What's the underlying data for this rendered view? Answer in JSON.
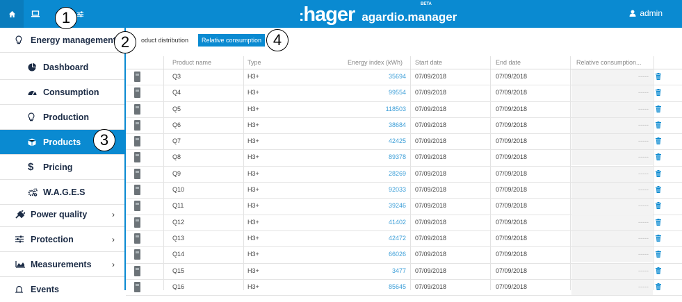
{
  "header": {
    "logo_colon": ":",
    "logo_text": "hager",
    "app_name": "agardio.manager",
    "beta": "BETA",
    "user": "admin",
    "icons": [
      "home-icon",
      "monitor-icon",
      "sliders-icon",
      "user-icon"
    ]
  },
  "callouts": [
    "1",
    "2",
    "3",
    "4"
  ],
  "sidebar": {
    "energy_management": "Energy management",
    "items": [
      {
        "label": "Dashboard",
        "icon": "pie-chart-icon"
      },
      {
        "label": "Consumption",
        "icon": "gauge-icon"
      },
      {
        "label": "Production",
        "icon": "lightbulb-icon"
      },
      {
        "label": "Products",
        "icon": "box-icon"
      },
      {
        "label": "Pricing",
        "icon": "dollar-icon"
      },
      {
        "label": "W.A.G.E.S",
        "icon": "gears-icon"
      }
    ],
    "power_quality": "Power quality",
    "protection": "Protection",
    "measurements": "Measurements",
    "events": "Events",
    "chevron": "›"
  },
  "tabs": {
    "product_distribution": "oduct distribution",
    "relative_consumption": "Relative consumption"
  },
  "table": {
    "headers": [
      "Product name",
      "Type",
      "Energy index (kWh)",
      "Start date",
      "End date",
      "Relative consumption..."
    ],
    "rows": [
      {
        "name": "Q3",
        "type": "H3+",
        "energy": "35694",
        "start": "07/09/2018",
        "end": "07/09/2018",
        "rel": "-----"
      },
      {
        "name": "Q4",
        "type": "H3+",
        "energy": "99554",
        "start": "07/09/2018",
        "end": "07/09/2018",
        "rel": "-----"
      },
      {
        "name": "Q5",
        "type": "H3+",
        "energy": "118503",
        "start": "07/09/2018",
        "end": "07/09/2018",
        "rel": "-----"
      },
      {
        "name": "Q6",
        "type": "H3+",
        "energy": "38684",
        "start": "07/09/2018",
        "end": "07/09/2018",
        "rel": "-----"
      },
      {
        "name": "Q7",
        "type": "H3+",
        "energy": "42425",
        "start": "07/09/2018",
        "end": "07/09/2018",
        "rel": "-----"
      },
      {
        "name": "Q8",
        "type": "H3+",
        "energy": "89378",
        "start": "07/09/2018",
        "end": "07/09/2018",
        "rel": "-----"
      },
      {
        "name": "Q9",
        "type": "H3+",
        "energy": "28269",
        "start": "07/09/2018",
        "end": "07/09/2018",
        "rel": "-----"
      },
      {
        "name": "Q10",
        "type": "H3+",
        "energy": "92033",
        "start": "07/09/2018",
        "end": "07/09/2018",
        "rel": "-----"
      },
      {
        "name": "Q11",
        "type": "H3+",
        "energy": "39246",
        "start": "07/09/2018",
        "end": "07/09/2018",
        "rel": "-----"
      },
      {
        "name": "Q12",
        "type": "H3+",
        "energy": "41402",
        "start": "07/09/2018",
        "end": "07/09/2018",
        "rel": "-----"
      },
      {
        "name": "Q13",
        "type": "H3+",
        "energy": "42472",
        "start": "07/09/2018",
        "end": "07/09/2018",
        "rel": "-----"
      },
      {
        "name": "Q14",
        "type": "H3+",
        "energy": "66026",
        "start": "07/09/2018",
        "end": "07/09/2018",
        "rel": "-----"
      },
      {
        "name": "Q15",
        "type": "H3+",
        "energy": "3477",
        "start": "07/09/2018",
        "end": "07/09/2018",
        "rel": "-----"
      },
      {
        "name": "Q16",
        "type": "H3+",
        "energy": "85645",
        "start": "07/09/2018",
        "end": "07/09/2018",
        "rel": "-----"
      }
    ]
  },
  "colors": {
    "primary": "#0a8ad1",
    "link": "#3d9fd8",
    "nav_text": "#1b2b45"
  }
}
